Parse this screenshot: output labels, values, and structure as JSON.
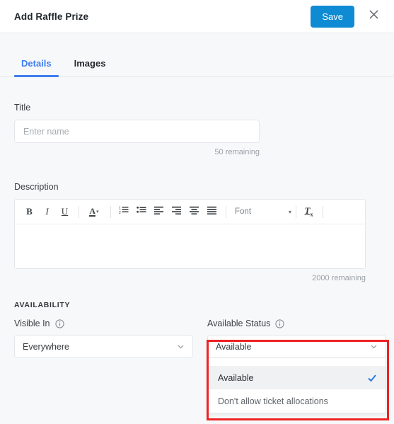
{
  "header": {
    "title": "Add Raffle Prize",
    "save_label": "Save",
    "close_icon": "close-icon"
  },
  "tabs": [
    {
      "label": "Details",
      "active": true
    },
    {
      "label": "Images",
      "active": false
    }
  ],
  "form": {
    "title_field": {
      "label": "Title",
      "value": "",
      "placeholder": "Enter name",
      "remaining": "50 remaining"
    },
    "description_field": {
      "label": "Description",
      "value": "",
      "remaining": "2000 remaining"
    }
  },
  "editor_toolbar": {
    "bold": "B",
    "italic": "I",
    "underline": "U",
    "text_color": "A",
    "caret": "▾",
    "numbered_list_icon": "numbered-list-icon",
    "bulleted_list_icon": "bulleted-list-icon",
    "align_left_icon": "align-left-icon",
    "align_right_icon": "align-right-icon",
    "align_center_icon": "align-center-icon",
    "justify_icon": "align-justify-icon",
    "font_label": "Font",
    "font_caret": "▾",
    "remove_format": "T",
    "remove_format_sub": "x"
  },
  "availability": {
    "section_title": "AVAILABILITY",
    "visible_in": {
      "label": "Visible In",
      "info_icon": "info-icon",
      "value": "Everywhere",
      "chevron": "chevron-down-icon"
    },
    "available_status": {
      "label": "Available Status",
      "info_icon": "info-icon",
      "value": "Available",
      "chevron": "chevron-down-icon",
      "options": [
        {
          "label": "Available",
          "selected": true
        },
        {
          "label": "Don't allow ticket allocations",
          "selected": false
        }
      ]
    }
  },
  "colors": {
    "accent_blue": "#0f8bd4",
    "tab_blue": "#3f7ef0",
    "check_blue": "#2b7de9",
    "highlight_red": "#ee2222",
    "page_bg": "#f7f8f9"
  }
}
